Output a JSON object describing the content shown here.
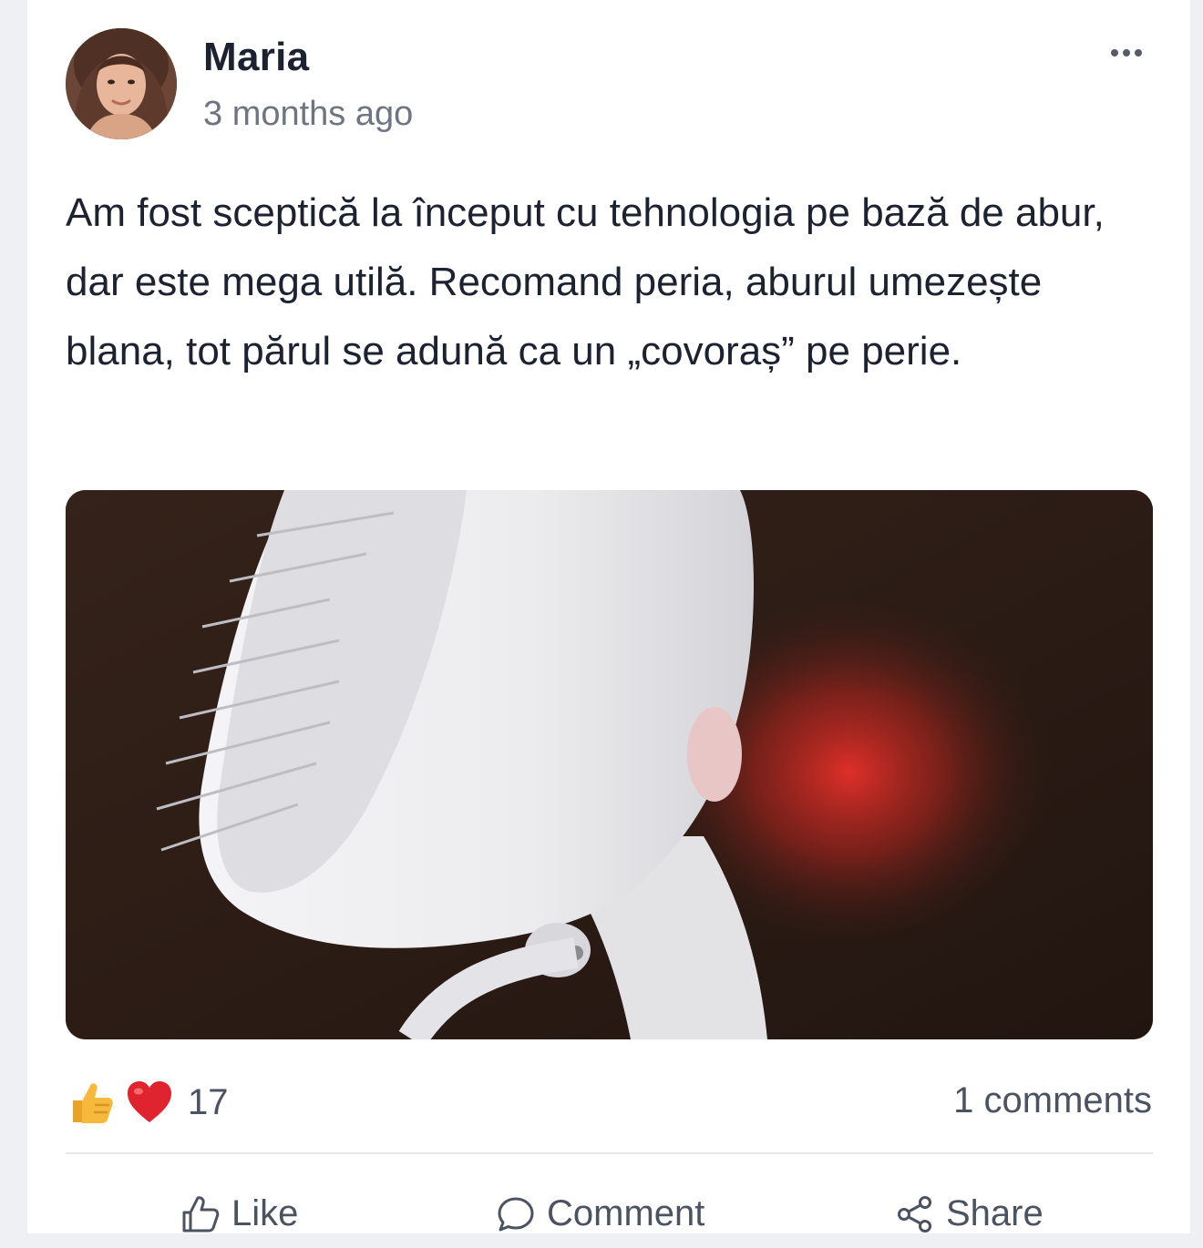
{
  "post": {
    "author": "Maria",
    "timestamp": "3 months ago",
    "text": "Am fost sceptică la început cu tehnologia pe bază de abur, dar este mega utilă. Recomand peria, aburul umezește blana, tot părul se adună ca un „covoraș” pe perie."
  },
  "icons": {
    "more": "more-horizontal-icon",
    "like_reaction": "thumbs-up-emoji-icon",
    "love_reaction": "heart-emoji-icon",
    "like_action": "thumbs-up-outline-icon",
    "comment_action": "speech-bubble-icon",
    "share_action": "share-nodes-icon"
  },
  "reactions": {
    "count": "17"
  },
  "comments": {
    "label": "1 comments"
  },
  "actions": {
    "like": "Like",
    "comment": "Comment",
    "share": "Share"
  },
  "colors": {
    "text_primary": "#1c2230",
    "text_secondary": "#6e7581",
    "divider": "#e6e8eb",
    "heart": "#e0242f",
    "thumb": "#f6b93b"
  }
}
